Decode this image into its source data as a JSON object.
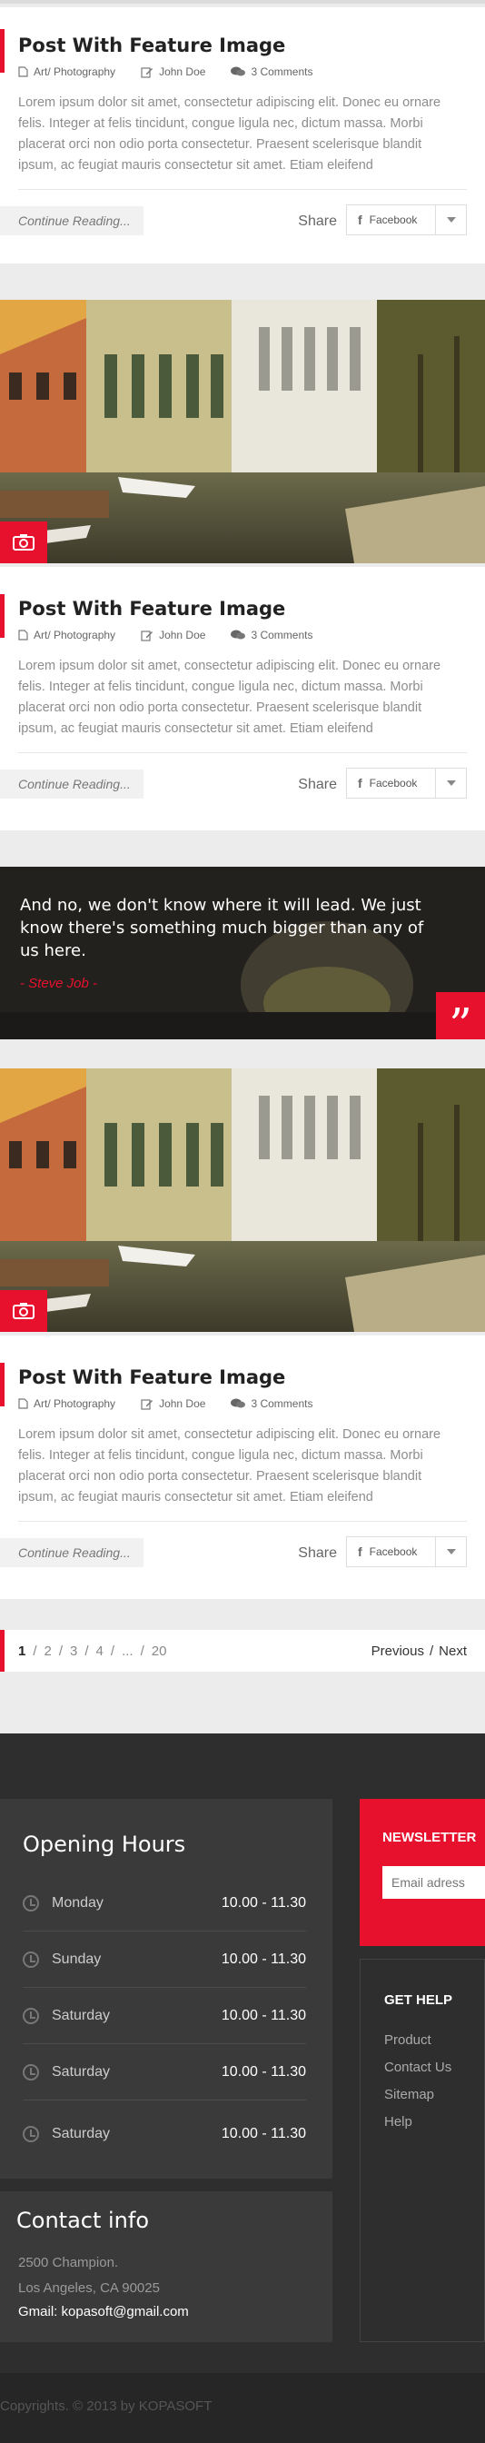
{
  "post": {
    "title": "Post With Feature Image",
    "category": "Art/ Photography",
    "author": "John Doe",
    "comments": "3 Comments",
    "excerpt": "Lorem ipsum dolor sit amet, consectetur adipiscing elit. Donec eu ornare felis. Integer at felis tincidunt, congue ligula nec, dictum massa. Morbi placerat orci non odio porta consectetur. Praesent scelerisque blandit ipsum, ac feugiat mauris consectetur sit amet. Etiam eleifend",
    "continue_label": "Continue Reading...",
    "share_label": "Share",
    "facebook_label": "Facebook"
  },
  "quote": {
    "text": "And no, we don't know where it will lead. We just know there's something much bigger than any of us here.",
    "author": "- Steve Job -"
  },
  "pagination": {
    "pages": [
      "1",
      "2",
      "3",
      "4",
      "...",
      "20"
    ],
    "current": "1",
    "previous": "Previous",
    "next": "Next"
  },
  "footer": {
    "hours_title": "Opening Hours",
    "hours": [
      {
        "day": "Monday",
        "time": "10.00 - 11.30"
      },
      {
        "day": "Sunday",
        "time": "10.00 - 11.30"
      },
      {
        "day": "Saturday",
        "time": "10.00 - 11.30"
      },
      {
        "day": "Saturday",
        "time": "10.00 - 11.30"
      },
      {
        "day": "Saturday",
        "time": "10.00 - 11.30"
      }
    ],
    "contact_title": "Contact info",
    "address_line1": "2500 Champion.",
    "address_line2": "Los Angeles, CA 90025",
    "email": "Gmail: kopasoft@gmail.com",
    "newsletter_title": "NEWSLETTER",
    "newsletter_placeholder": "Email adress",
    "help_title": "GET HELP",
    "help_links": [
      "Product",
      "Contact Us",
      "Sitemap",
      "Help"
    ],
    "copyright": "Copyrights. © 2013 by KOPASOFT"
  },
  "colors": {
    "accent": "#e8112d",
    "footer_bg": "#2e2e2e"
  },
  "icons": [
    "folder-icon",
    "edit-icon",
    "comments-icon",
    "facebook-icon",
    "chevron-down-icon",
    "camera-icon",
    "quote-icon",
    "clock-icon"
  ]
}
